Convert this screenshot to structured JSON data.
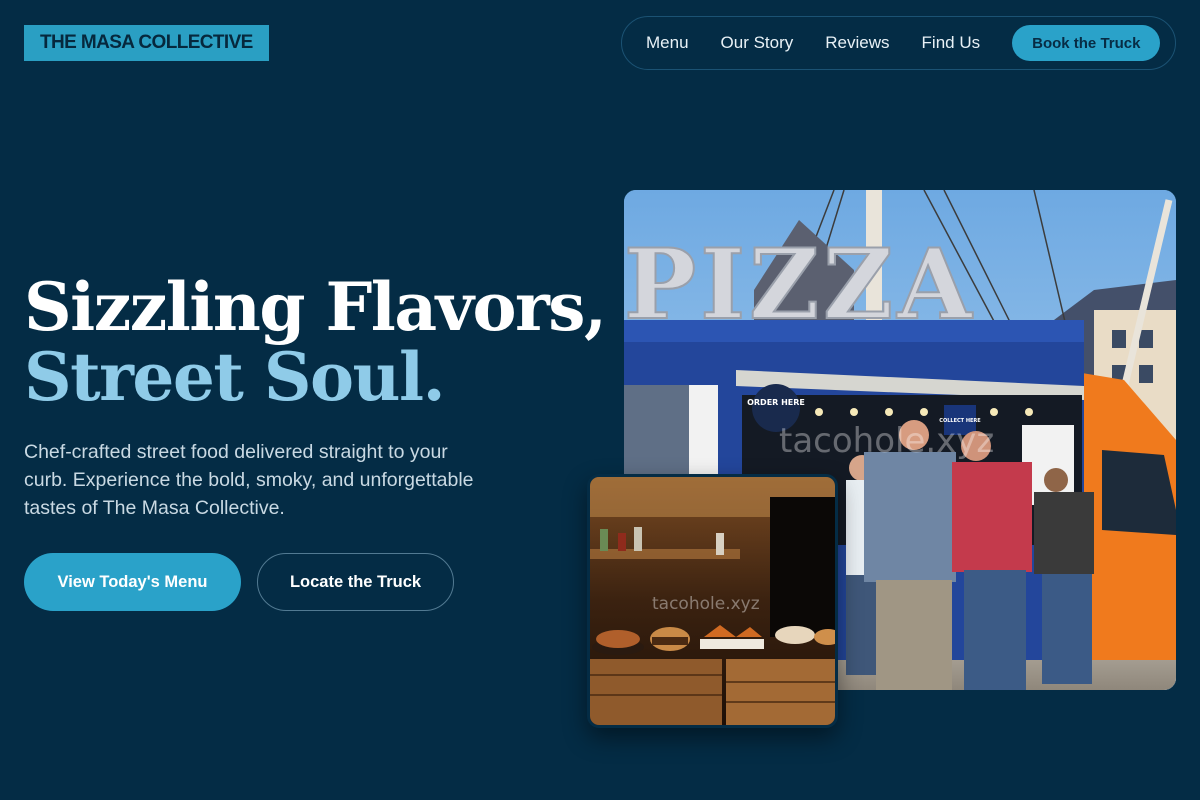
{
  "brand": {
    "name": "THE MASA COLLECTIVE"
  },
  "nav": {
    "links": [
      "Menu",
      "Our Story",
      "Reviews",
      "Find Us"
    ],
    "cta": "Book the Truck"
  },
  "hero": {
    "title_line1": "Sizzling Flavors,",
    "title_line2": "Street Soul.",
    "subtitle": "Chef-crafted street food delivered straight to your curb. Experience the bold, smoky, and unforgettable tastes of The Masa Collective.",
    "primary_button": "View Today's Menu",
    "secondary_button": "Locate the Truck"
  },
  "images": {
    "main_alt": "Customers ordering at a blue and orange food truck under a PIZZA marquee sign",
    "main_sign_text": "PIZZA",
    "main_order_badge": "ORDER HERE",
    "main_collect_badge": "COLLECT HERE",
    "main_watermark": "tacohole.xyz",
    "inset_alt": "Street food plates displayed on wooden crates",
    "inset_watermark": "tacohole.xyz"
  },
  "colors": {
    "background": "#042c45",
    "accent": "#2aa2c9",
    "title_highlight": "#8fcbe8"
  }
}
